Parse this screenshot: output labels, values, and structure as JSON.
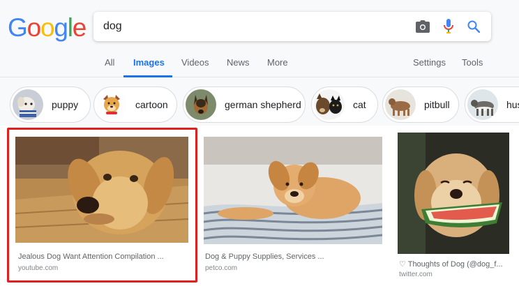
{
  "logo": {
    "letters": [
      "G",
      "o",
      "o",
      "g",
      "l",
      "e"
    ],
    "colors": [
      "#4285f4",
      "#ea4335",
      "#fbbc05",
      "#4285f4",
      "#34a853",
      "#ea4335"
    ]
  },
  "search": {
    "query": "dog"
  },
  "tabs": [
    {
      "label": "All"
    },
    {
      "label": "Images"
    },
    {
      "label": "Videos"
    },
    {
      "label": "News"
    },
    {
      "label": "More"
    },
    {
      "label": "Settings"
    },
    {
      "label": "Tools"
    }
  ],
  "active_tab": "Images",
  "accent_color": "#1a73e8",
  "chips": [
    {
      "label": "puppy",
      "icon": "puppy-thumbnail"
    },
    {
      "label": "cartoon",
      "icon": "cartoon-dog-thumbnail"
    },
    {
      "label": "german shepherd",
      "icon": "german-shepherd-thumbnail"
    },
    {
      "label": "cat",
      "icon": "cat-thumbnail"
    },
    {
      "label": "pitbull",
      "icon": "pitbull-thumbnail"
    },
    {
      "label": "hus",
      "icon": "husky-thumbnail"
    }
  ],
  "results": [
    {
      "title": "Jealous Dog Want Attention Compilation ...",
      "source": "youtube.com",
      "image": "golden-retriever-lying-on-floor",
      "selected": true
    },
    {
      "title": "Dog & Puppy Supplies, Services ...",
      "source": "petco.com",
      "image": "puppy-on-striped-blanket"
    },
    {
      "title": "♡ Thoughts of Dog (@dog_f...",
      "source": "twitter.com",
      "image": "dog-eating-watermelon"
    }
  ],
  "highlight_color": "#e0201f"
}
